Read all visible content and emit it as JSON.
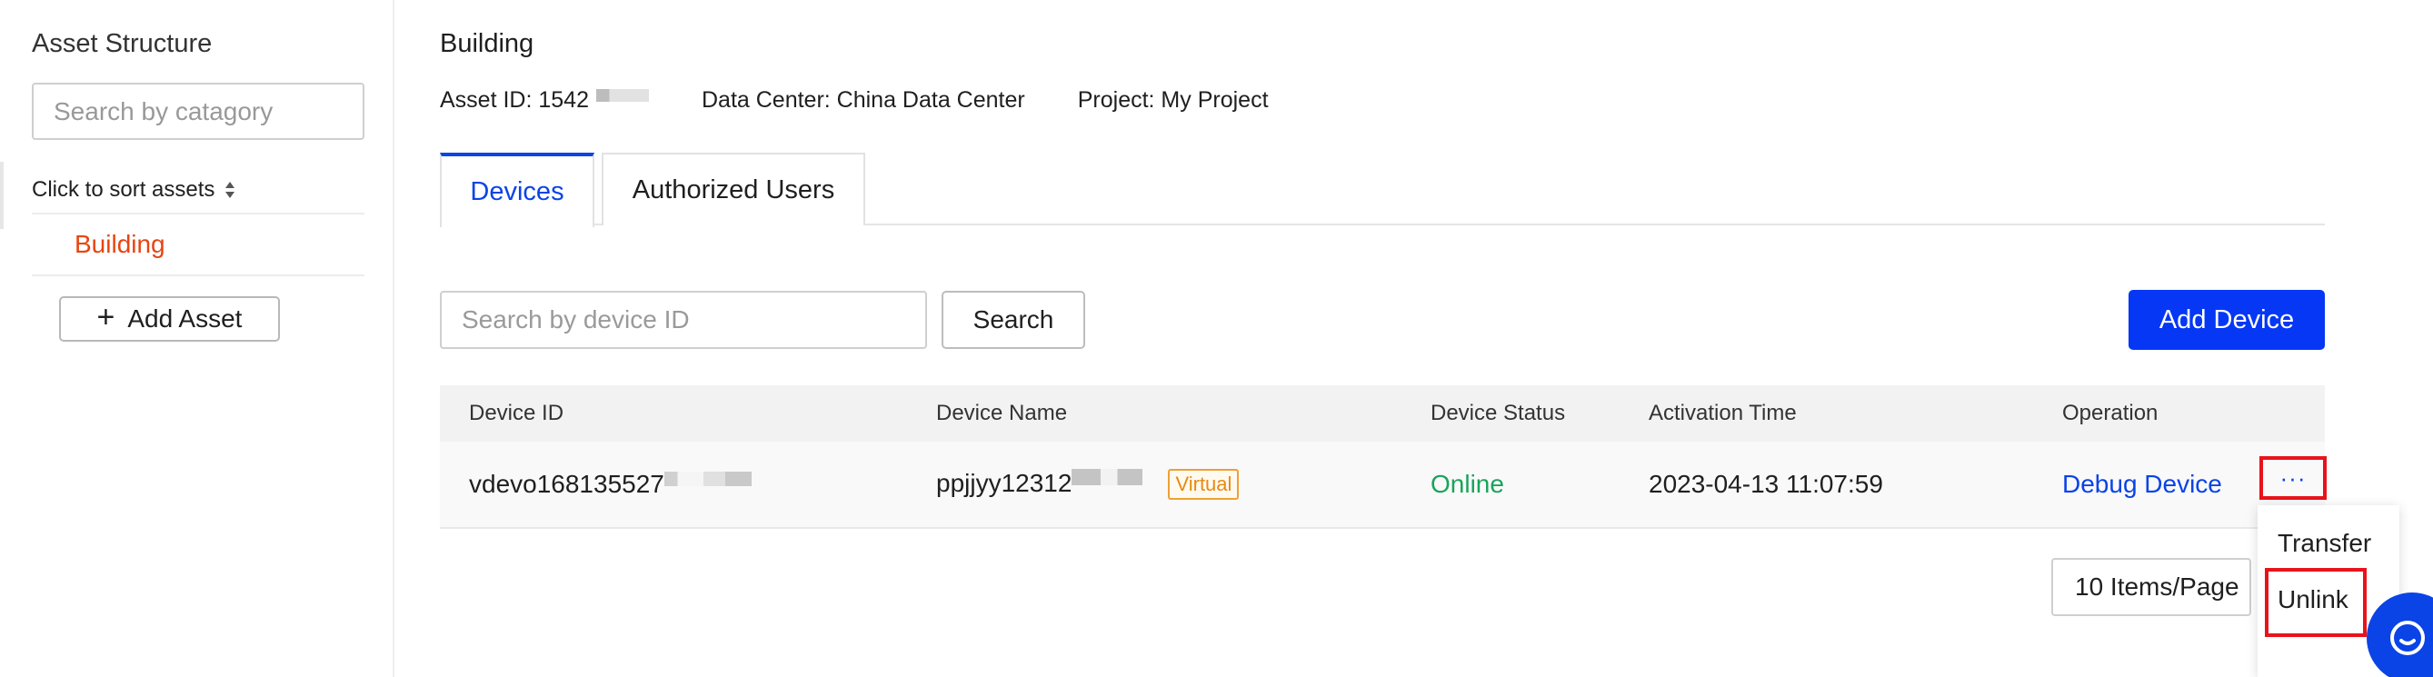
{
  "sidebar": {
    "title": "Asset Structure",
    "search_placeholder": "Search by catagory",
    "sort_label": "Click to sort assets",
    "tree": [
      {
        "label": "Building",
        "selected": true
      }
    ],
    "add_asset_label": "Add Asset"
  },
  "header": {
    "title": "Building",
    "asset_id_label": "Asset ID: 1542",
    "data_center": "Data Center: China Data Center",
    "project": "Project: My Project"
  },
  "tabs": [
    {
      "label": "Devices",
      "active": true
    },
    {
      "label": "Authorized Users",
      "active": false
    }
  ],
  "toolbar": {
    "search_placeholder": "Search by device ID",
    "search_label": "Search",
    "add_device_label": "Add Device"
  },
  "table": {
    "columns": [
      "Device ID",
      "Device Name",
      "Device Status",
      "Activation Time",
      "Operation"
    ],
    "rows": [
      {
        "device_id": "vdevo168135527",
        "device_name": "ppjjyy12312",
        "tag": "Virtual",
        "status": "Online",
        "activation_time": "2023-04-13 11:07:59",
        "operation": "Debug Device",
        "more": "···"
      }
    ]
  },
  "pagination": {
    "page_size_label": "10 Items/Page"
  },
  "more_menu": {
    "items": [
      "Transfer",
      "Unlink"
    ]
  },
  "colors": {
    "primary": "#0537f5",
    "selected_asset": "#e8440f",
    "online": "#1aa35a",
    "virtual_tag": "#e88a10",
    "highlight_box": "#e8131b"
  },
  "icons": {
    "sort": "sort-updown-icon",
    "plus": "plus-icon",
    "chat": "chat-bubble-icon"
  }
}
